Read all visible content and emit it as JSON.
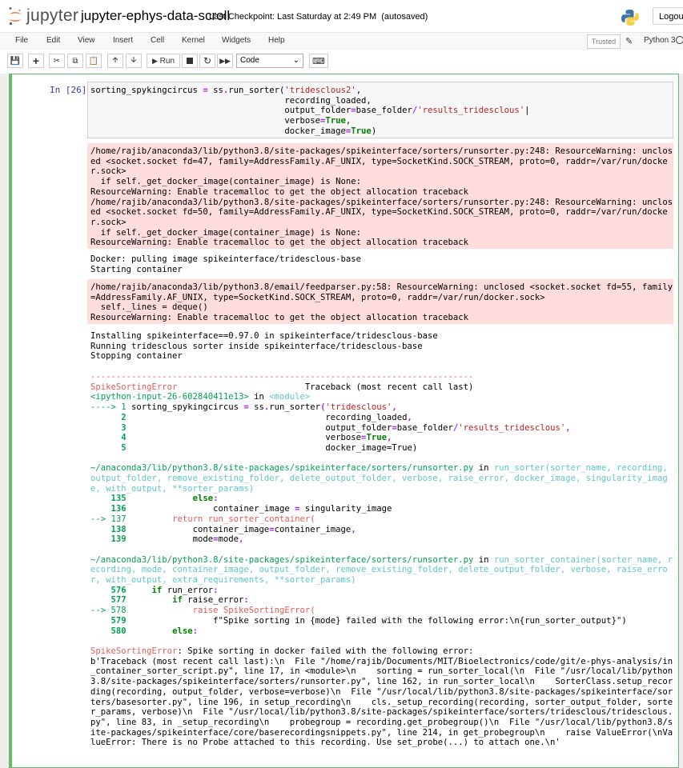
{
  "header": {
    "logo_text": "jupyter",
    "notebook_name": "jupyter-ephys-data-scroll",
    "checkpoint": "Last Checkpoint: Last Saturday at 2:49 PM",
    "autosave": "(autosaved)",
    "logout_label": "Logout"
  },
  "menubar": {
    "items": [
      "File",
      "Edit",
      "View",
      "Insert",
      "Cell",
      "Kernel",
      "Widgets",
      "Help"
    ],
    "trusted_label": "Trusted",
    "kernel_name": "Python 3"
  },
  "toolbar": {
    "run_label": "Run",
    "cell_type": "Code"
  },
  "cell": {
    "prompt": "In [26]:",
    "code": [
      "sorting_spykingcircus = ss.run_sorter('tridesclous2',",
      "                                      recording_loaded,",
      "                                      output_folder=base_folder/'results_tridesclous',",
      "                                      verbose=True,",
      "                                      docker_image=True)"
    ],
    "stderr1": [
      "/home/rajib/anaconda3/lib/python3.8/site-packages/spikeinterface/sorters/runsorter.py:248: ResourceWarning: unclos",
      "ed <socket.socket fd=47, family=AddressFamily.AF_UNIX, type=SocketKind.SOCK_STREAM, proto=0, raddr=/var/run/docke",
      "r.sock>",
      "  if self._get_docker_image(container_image) is None:",
      "ResourceWarning: Enable tracemalloc to get the object allocation traceback",
      "/home/rajib/anaconda3/lib/python3.8/site-packages/spikeinterface/sorters/runsorter.py:248: ResourceWarning: unclos",
      "ed <socket.socket fd=50, family=AddressFamily.AF_UNIX, type=SocketKind.SOCK_STREAM, proto=0, raddr=/var/run/docke",
      "r.sock>",
      "  if self._get_docker_image(container_image) is None:",
      "ResourceWarning: Enable tracemalloc to get the object allocation traceback"
    ],
    "stdout1": [
      "Docker: pulling image spikeinterface/tridesclous-base",
      "Starting container"
    ],
    "stderr2": [
      "/home/rajib/anaconda3/lib/python3.8/email/feedparser.py:58: ResourceWarning: unclosed <socket.socket fd=55, family",
      "=AddressFamily.AF_UNIX, type=SocketKind.SOCK_STREAM, proto=0, raddr=/var/run/docker.sock>",
      "  self._lines = deque()",
      "ResourceWarning: Enable tracemalloc to get the object allocation traceback"
    ],
    "stdout2": [
      "Installing spikeinterface==0.97.0 in spikeinterface/tridesclous-base",
      "Running tridesclous sorter inside spikeinterface/tridesclous-base",
      "Stopping container"
    ],
    "traceback": {
      "dashes": "---------------------------------------------------------------------------",
      "error_name": "SpikeSortingError",
      "header_right": "Traceback (most recent call last)",
      "frame0_file": "<ipython-input-26-602840411e13>",
      "frame0_in": " in ",
      "frame0_func": "<module>",
      "frame1_path": "~/anaconda3/lib/python3.8/site-packages/spikeinterface/sorters/runsorter.py",
      "frame1_sig_a": "run_sorter",
      "frame1_sig_b": "(sorter_name, recording,",
      "frame1_sig_2": "output_folder, remove_existing_folder, delete_output_folder, verbose, raise_error, docker_image, singularity_imag",
      "frame1_sig_3": "e, with_output, **sorter_params)",
      "frame2_path": "~/anaconda3/lib/python3.8/site-packages/spikeinterface/sorters/runsorter.py",
      "frame2_sig_a": "run_sorter_container",
      "frame2_sig_b": "(sorter_name, r",
      "frame2_sig_2": "ecording, mode, container_image, output_folder, remove_existing_folder, delete_output_folder, verbose, raise_erro",
      "frame2_sig_3": "r, with_output, extra_requirements, **sorter_params)",
      "final_message": [
        ": Spike sorting in docker failed with the following error:",
        "b'Traceback (most recent call last):\\n  File \"/home/rajib/Documents/MIT/Bioelectronics/code/git/e-phys-analysis/in",
        "_container_sorter_script.py\", line 17, in <module>\\n    sorting = run_sorter_local(\\n  File \"/usr/local/lib/python",
        "3.8/site-packages/spikeinterface/sorters/runsorter.py\", line 162, in run_sorter_local\\n    SorterClass.setup_recor",
        "ding(recording, output_folder, verbose=verbose)\\n  File \"/usr/local/lib/python3.8/site-packages/spikeinterface/sor",
        "ters/basesorter.py\", line 196, in setup_recording\\n    cls._setup_recording(recording, sorter_output_folder, sorte",
        "r_params, verbose)\\n  File \"/usr/local/lib/python3.8/site-packages/spikeinterface/sorters/tridesclous/tridesclous.",
        "py\", line 83, in _setup_recording\\n    probegroup = recording.get_probegroup()\\n  File \"/usr/local/lib/python3.8/s",
        "ite-packages/spikeinterface/core/baserecordingsnippets.py\", line 214, in get_probegroup\\n    raise ValueError(\\nVa",
        "lueError: There is no Probe attached to this recording. Use set_probe(...) to attach one.\\n'"
      ]
    }
  }
}
